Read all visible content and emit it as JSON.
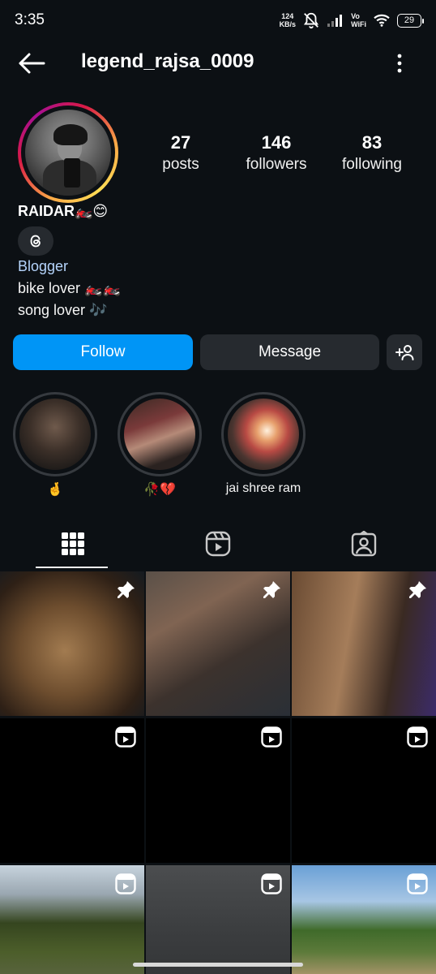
{
  "status_bar": {
    "time": "3:35",
    "net_speed_value": "124",
    "net_speed_unit": "KB/s",
    "vowifi_top": "Vo",
    "vowifi_bottom": "WiFi",
    "battery": "29",
    "icons": [
      "mute-bell-icon",
      "signal-icon",
      "wifi-icon",
      "battery-icon"
    ]
  },
  "header": {
    "username": "legend_rajsa_0009",
    "back_icon": "arrow-left-icon",
    "more_icon": "vertical-dots-icon"
  },
  "profile": {
    "stats": [
      {
        "value": "27",
        "label": "posts"
      },
      {
        "value": "146",
        "label": "followers"
      },
      {
        "value": "83",
        "label": "following"
      }
    ],
    "display_name": "RAIDAR🏍️😊",
    "threads_icon": "threads-icon",
    "category": "Blogger",
    "bio": [
      "bike lover 🏍️🏍️",
      "song lover 🎶"
    ]
  },
  "actions": {
    "follow": "Follow",
    "message": "Message",
    "add_user_icon": "add-person-icon"
  },
  "highlights": [
    {
      "label": "🤞"
    },
    {
      "label": "🥀💔"
    },
    {
      "label": "jai shree ram"
    }
  ],
  "tabs": [
    {
      "icon": "grid-icon",
      "active": true
    },
    {
      "icon": "reels-icon",
      "active": false
    },
    {
      "icon": "tagged-icon",
      "active": false
    }
  ],
  "posts": [
    {
      "badge": "pin-icon"
    },
    {
      "badge": "pin-icon"
    },
    {
      "badge": "pin-icon"
    },
    {
      "badge": "reel-icon"
    },
    {
      "badge": "reel-icon"
    },
    {
      "badge": "reel-icon"
    },
    {
      "badge": "reel-icon"
    },
    {
      "badge": "reel-icon"
    },
    {
      "badge": "reel-icon"
    }
  ],
  "colors": {
    "background": "#0c1014",
    "follow_button": "#0095f6",
    "secondary_button": "#262a2f",
    "category_link": "#b5d4fc"
  }
}
